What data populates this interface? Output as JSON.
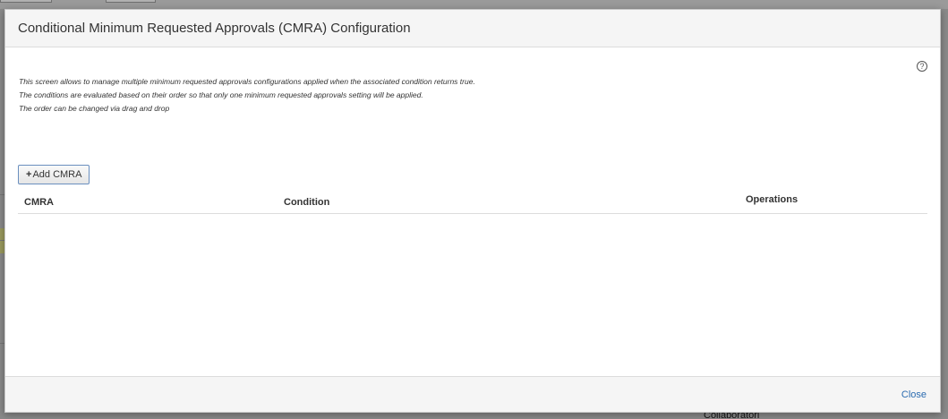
{
  "background": {
    "bottom_text": "Collaboratori"
  },
  "modal": {
    "title": "Conditional Minimum Requested Approvals (CMRA) Configuration",
    "help_icon": "question-circle-icon",
    "description": [
      "This screen allows to manage multiple minimum requested approvals configurations applied when the associated condition returns true.",
      "The conditions are evaluated based on their order so that only one minimum requested approvals setting will be applied.",
      "The order can be changed via drag and drop"
    ],
    "add_button_label": "Add CMRA",
    "add_button_icon": "plus-icon",
    "table": {
      "columns": [
        "CMRA",
        "Condition",
        "Operations"
      ],
      "rows": []
    },
    "footer": {
      "close_label": "Close"
    }
  },
  "colors": {
    "link": "#2a6bb0",
    "button_border": "#6a8fbf",
    "header_bg": "#f5f5f5"
  }
}
